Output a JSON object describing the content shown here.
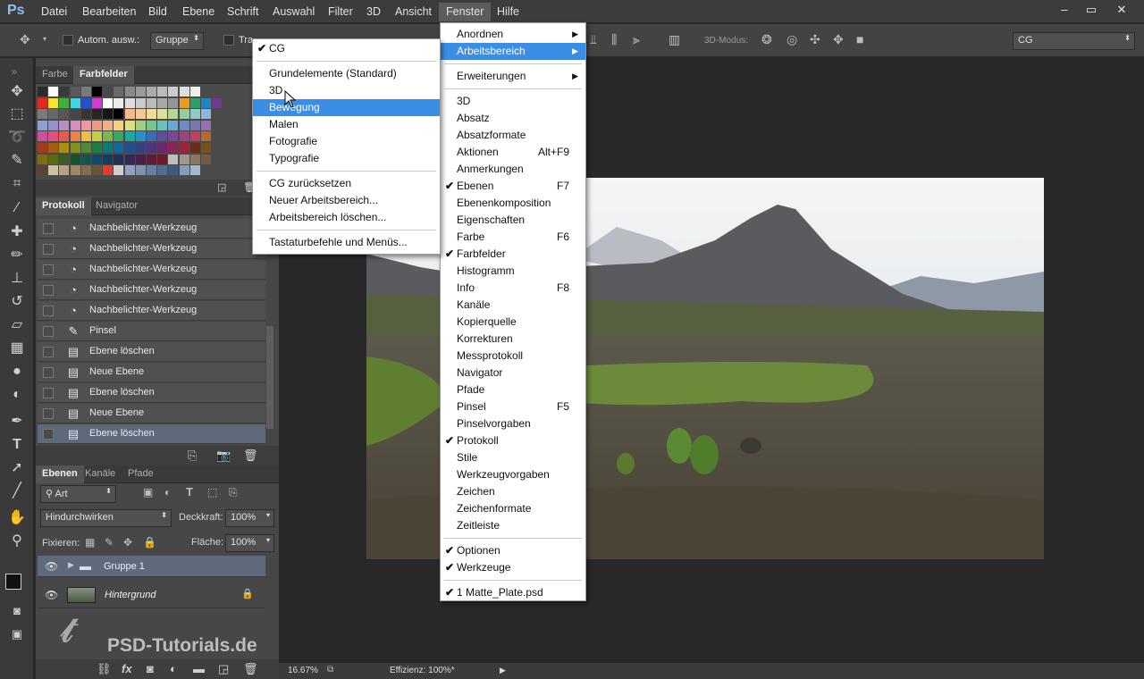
{
  "app": {
    "logo": "Ps"
  },
  "menubar": {
    "items": [
      "Datei",
      "Bearbeiten",
      "Bild",
      "Ebene",
      "Schrift",
      "Auswahl",
      "Filter",
      "3D",
      "Ansicht",
      "Fenster",
      "Hilfe"
    ],
    "active": "Fenster",
    "window_buttons": [
      "–",
      "▭",
      "✕"
    ]
  },
  "options_bar": {
    "auto_select_label": "Autom. ausw.:",
    "auto_select_value": "Gruppe",
    "transform_label": "Tra",
    "mode_label": "3D-Modus:",
    "workspace_value": "CG"
  },
  "panels": {
    "swatch_tabs": [
      "Farbe",
      "Farbfelder"
    ],
    "history_tabs": [
      "Protokoll",
      "Navigator"
    ],
    "history_items": [
      {
        "icon": "brush-dodge-icon",
        "label": "Nachbelichter-Werkzeug"
      },
      {
        "icon": "brush-dodge-icon",
        "label": "Nachbelichter-Werkzeug"
      },
      {
        "icon": "brush-dodge-icon",
        "label": "Nachbelichter-Werkzeug"
      },
      {
        "icon": "brush-dodge-icon",
        "label": "Nachbelichter-Werkzeug"
      },
      {
        "icon": "brush-dodge-icon",
        "label": "Nachbelichter-Werkzeug"
      },
      {
        "icon": "brush-icon",
        "label": "Pinsel"
      },
      {
        "icon": "document-icon",
        "label": "Ebene löschen"
      },
      {
        "icon": "document-icon",
        "label": "Neue Ebene"
      },
      {
        "icon": "document-icon",
        "label": "Ebene löschen"
      },
      {
        "icon": "document-icon",
        "label": "Neue Ebene"
      },
      {
        "icon": "document-icon",
        "label": "Ebene löschen"
      }
    ],
    "layers_tabs": [
      "Ebenen",
      "Kanäle",
      "Pfade"
    ],
    "filter_kind": "Art",
    "blend_mode": "Hindurchwirken",
    "opacity_label": "Deckkraft:",
    "opacity_value": "100%",
    "lock_label": "Fixieren:",
    "fill_label": "Fläche:",
    "fill_value": "100%",
    "layers": [
      {
        "name": "Gruppe 1",
        "type": "group"
      },
      {
        "name": "Hintergrund",
        "type": "background"
      }
    ]
  },
  "watermark": "PSD-Tutorials.de",
  "status": {
    "zoom": "16.67%",
    "efficiency": "Effizienz: 100%*"
  },
  "arbeitsbereich_menu": {
    "checked": "CG",
    "group1": [
      "Grundelemente (Standard)",
      "3D",
      "Bewegung",
      "Malen",
      "Fotografie",
      "Typografie"
    ],
    "highlighted": "Bewegung",
    "group2": [
      "CG zurücksetzen",
      "Neuer Arbeitsbereich...",
      "Arbeitsbereich löschen..."
    ],
    "group3": [
      "Tastaturbefehle und Menüs..."
    ]
  },
  "fenster_menu": {
    "top": [
      {
        "label": "Anordnen",
        "submenu": true
      },
      {
        "label": "Arbeitsbereich",
        "submenu": true,
        "highlighted": true
      }
    ],
    "ext": [
      {
        "label": "Erweiterungen",
        "submenu": true
      }
    ],
    "panels": [
      {
        "label": "3D"
      },
      {
        "label": "Absatz"
      },
      {
        "label": "Absatzformate"
      },
      {
        "label": "Aktionen",
        "shortcut": "Alt+F9"
      },
      {
        "label": "Anmerkungen"
      },
      {
        "label": "Ebenen",
        "shortcut": "F7",
        "checked": true
      },
      {
        "label": "Ebenenkomposition"
      },
      {
        "label": "Eigenschaften"
      },
      {
        "label": "Farbe",
        "shortcut": "F6"
      },
      {
        "label": "Farbfelder",
        "checked": true
      },
      {
        "label": "Histogramm"
      },
      {
        "label": "Info",
        "shortcut": "F8"
      },
      {
        "label": "Kanäle"
      },
      {
        "label": "Kopierquelle"
      },
      {
        "label": "Korrekturen"
      },
      {
        "label": "Messprotokoll"
      },
      {
        "label": "Navigator"
      },
      {
        "label": "Pfade"
      },
      {
        "label": "Pinsel",
        "shortcut": "F5"
      },
      {
        "label": "Pinselvorgaben"
      },
      {
        "label": "Protokoll",
        "checked": true
      },
      {
        "label": "Stile"
      },
      {
        "label": "Werkzeugvorgaben"
      },
      {
        "label": "Zeichen"
      },
      {
        "label": "Zeichenformate"
      },
      {
        "label": "Zeitleiste"
      }
    ],
    "bottom1": [
      {
        "label": "Optionen",
        "checked": true
      },
      {
        "label": "Werkzeuge",
        "checked": true
      }
    ],
    "bottom2": [
      {
        "label": "1 Matte_Plate.psd",
        "checked": true
      }
    ]
  }
}
